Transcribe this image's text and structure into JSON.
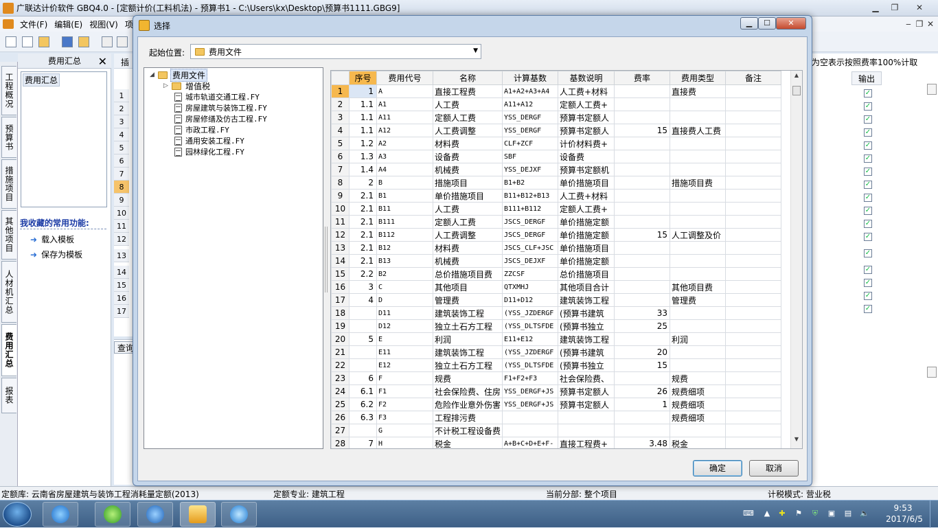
{
  "app": {
    "title": "广联达计价软件 GBQ4.0 - [定额计价(工料机法) - 预算书1 - C:\\Users\\kx\\Desktop\\预算书1111.GBG9]",
    "menu": [
      "文件(F)",
      "编辑(E)",
      "视图(V)",
      "项目"
    ]
  },
  "vtabs": [
    "工程概况",
    "预算书",
    "措施项目",
    "其他项目",
    "人材机汇总",
    "费用汇总",
    "报表"
  ],
  "left_panel": {
    "header": "费用汇总",
    "close": "✕",
    "list_item": "费用汇总",
    "favorites_title": "我收藏的常用功能:",
    "favorites": [
      "载入模板",
      "保存为模板"
    ]
  },
  "background": {
    "row_numbers": [
      "1",
      "2",
      "3",
      "4",
      "5",
      "6",
      "7",
      "8",
      "9",
      "10",
      "11",
      "12",
      "13",
      "14",
      "15",
      "16",
      "17"
    ],
    "selected_row": "8",
    "note": "为空表示按照费率100%计取",
    "output_header": "输出",
    "lower_tab": "查询",
    "toolbar_label": "插"
  },
  "status": {
    "quota_lib": "定额库: 云南省房屋建筑与装饰工程消耗量定额(2013)",
    "quota_major": "定额专业: 建筑工程",
    "current_part": "当前分部: 整个项目",
    "tax_mode": "计税模式: 营业税"
  },
  "taskbar": {
    "time": "9:53",
    "date": "2017/6/5"
  },
  "dialog": {
    "title": "选择",
    "location_label": "起始位置:",
    "location_value": "费用文件",
    "tree": {
      "root": "费用文件",
      "folder": "增值税",
      "files": [
        "城市轨道交通工程.FY",
        "房屋建筑与装饰工程.FY",
        "房屋修缮及仿古工程.FY",
        "市政工程.FY",
        "通用安装工程.FY",
        "园林绿化工程.FY"
      ]
    },
    "columns": [
      "序号",
      "费用代号",
      "名称",
      "计算基数",
      "基数说明",
      "费率",
      "费用类型",
      "备注"
    ],
    "rows": [
      {
        "n": "1",
        "seq": "1",
        "code": "A",
        "name": "直接工程费",
        "base": "A1+A2+A3+A4",
        "desc": "人工费+材料",
        "rate": "",
        "type": "直接费",
        "note": ""
      },
      {
        "n": "2",
        "seq": "1.1",
        "code": "A1",
        "name": "人工费",
        "base": "A11+A12",
        "desc": "定额人工费+",
        "rate": "",
        "type": "",
        "note": ""
      },
      {
        "n": "3",
        "seq": "1.1",
        "code": "A11",
        "name": "定额人工费",
        "base": "YSS_DERGF",
        "desc": "预算书定额人",
        "rate": "",
        "type": "",
        "note": ""
      },
      {
        "n": "4",
        "seq": "1.1",
        "code": "A12",
        "name": "人工费调整",
        "base": "YSS_DERGF",
        "desc": "预算书定额人",
        "rate": "15",
        "type": "直接费人工费",
        "note": ""
      },
      {
        "n": "5",
        "seq": "1.2",
        "code": "A2",
        "name": "材料费",
        "base": "CLF+ZCF",
        "desc": "计价材料费+",
        "rate": "",
        "type": "",
        "note": ""
      },
      {
        "n": "6",
        "seq": "1.3",
        "code": "A3",
        "name": "设备费",
        "base": "SBF",
        "desc": "设备费",
        "rate": "",
        "type": "",
        "note": ""
      },
      {
        "n": "7",
        "seq": "1.4",
        "code": "A4",
        "name": "机械费",
        "base": "YSS_DEJXF",
        "desc": "预算书定额机",
        "rate": "",
        "type": "",
        "note": ""
      },
      {
        "n": "8",
        "seq": "2",
        "code": "B",
        "name": "措施项目",
        "base": "B1+B2",
        "desc": "单价措施项目",
        "rate": "",
        "type": "措施项目费",
        "note": ""
      },
      {
        "n": "9",
        "seq": "2.1",
        "code": "B1",
        "name": "单价措施项目",
        "base": "B11+B12+B13",
        "desc": "人工费+材料",
        "rate": "",
        "type": "",
        "note": ""
      },
      {
        "n": "10",
        "seq": "2.1",
        "code": "B11",
        "name": "人工费",
        "base": "B111+B112",
        "desc": "定额人工费+",
        "rate": "",
        "type": "",
        "note": ""
      },
      {
        "n": "11",
        "seq": "2.1",
        "code": "B111",
        "name": "定额人工费",
        "base": "JSCS_DERGF",
        "desc": "单价措施定额",
        "rate": "",
        "type": "",
        "note": ""
      },
      {
        "n": "12",
        "seq": "2.1",
        "code": "B112",
        "name": "人工费调整",
        "base": "JSCS_DERGF",
        "desc": "单价措施定额",
        "rate": "15",
        "type": "人工调整及价",
        "note": ""
      },
      {
        "n": "13",
        "seq": "2.1",
        "code": "B12",
        "name": "材料费",
        "base": "JSCS_CLF+JSC",
        "desc": "单价措施项目",
        "rate": "",
        "type": "",
        "note": ""
      },
      {
        "n": "14",
        "seq": "2.1",
        "code": "B13",
        "name": "机械费",
        "base": "JSCS_DEJXF",
        "desc": "单价措施定额",
        "rate": "",
        "type": "",
        "note": ""
      },
      {
        "n": "15",
        "seq": "2.2",
        "code": "B2",
        "name": "总价措施项目费",
        "base": "ZZCSF",
        "desc": "总价措施项目",
        "rate": "",
        "type": "",
        "note": ""
      },
      {
        "n": "16",
        "seq": "3",
        "code": "C",
        "name": "其他项目",
        "base": "QTXMHJ",
        "desc": "其他项目合计",
        "rate": "",
        "type": "其他项目费",
        "note": ""
      },
      {
        "n": "17",
        "seq": "4",
        "code": "D",
        "name": "管理费",
        "base": "D11+D12",
        "desc": "建筑装饰工程",
        "rate": "",
        "type": "管理费",
        "note": ""
      },
      {
        "n": "18",
        "seq": "",
        "code": "D11",
        "name": "建筑装饰工程",
        "base": "(YSS_JZDERGF",
        "desc": "(预算书建筑",
        "rate": "33",
        "type": "",
        "note": ""
      },
      {
        "n": "19",
        "seq": "",
        "code": "D12",
        "name": "独立土石方工程",
        "base": "(YSS_DLTSFDE",
        "desc": "(预算书独立",
        "rate": "25",
        "type": "",
        "note": ""
      },
      {
        "n": "20",
        "seq": "5",
        "code": "E",
        "name": "利润",
        "base": "E11+E12",
        "desc": "建筑装饰工程",
        "rate": "",
        "type": "利润",
        "note": ""
      },
      {
        "n": "21",
        "seq": "",
        "code": "E11",
        "name": "建筑装饰工程",
        "base": "(YSS_JZDERGF",
        "desc": "(预算书建筑",
        "rate": "20",
        "type": "",
        "note": ""
      },
      {
        "n": "22",
        "seq": "",
        "code": "E12",
        "name": "独立土石方工程",
        "base": "(YSS_DLTSFDE",
        "desc": "(预算书独立",
        "rate": "15",
        "type": "",
        "note": ""
      },
      {
        "n": "23",
        "seq": "6",
        "code": "F",
        "name": "规费",
        "base": "F1+F2+F3",
        "desc": "社会保险费、",
        "rate": "",
        "type": "规费",
        "note": ""
      },
      {
        "n": "24",
        "seq": "6.1",
        "code": "F1",
        "name": "社会保险费、住房",
        "base": "YSS_DERGF+JS",
        "desc": "预算书定额人",
        "rate": "26",
        "type": "规费细项",
        "note": ""
      },
      {
        "n": "25",
        "seq": "6.2",
        "code": "F2",
        "name": "危险作业意外伤害",
        "base": "YSS_DERGF+JS",
        "desc": "预算书定额人",
        "rate": "1",
        "type": "规费细项",
        "note": ""
      },
      {
        "n": "26",
        "seq": "6.3",
        "code": "F3",
        "name": "工程排污费",
        "base": "",
        "desc": "",
        "rate": "",
        "type": "规费细项",
        "note": ""
      },
      {
        "n": "27",
        "seq": "",
        "code": "G",
        "name": "不计税工程设备费",
        "base": "",
        "desc": "",
        "rate": "",
        "type": "",
        "note": ""
      },
      {
        "n": "28",
        "seq": "7",
        "code": "H",
        "name": "税金",
        "base": "A+B+C+D+E+F-",
        "desc": "直接工程费+",
        "rate": "3.48",
        "type": "税金",
        "note": ""
      }
    ],
    "ok": "确定",
    "cancel": "取消"
  }
}
